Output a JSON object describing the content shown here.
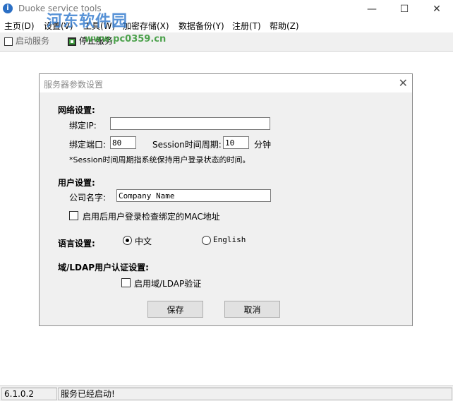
{
  "window": {
    "title": "Duoke service tools",
    "controls": {
      "minimize": "—",
      "maximize": "☐",
      "close": "✕"
    }
  },
  "watermark": {
    "text": "河东软件园",
    "url": "www.pc0359.cn"
  },
  "menu": {
    "items": [
      "主页(D)",
      "设置(V)",
      "工具(W)",
      "加密存储(X)",
      "数据备份(Y)",
      "注册(T)",
      "帮助(Z)"
    ]
  },
  "toolbar": {
    "start_label": "启动服务",
    "stop_label": "停止服务"
  },
  "dialog": {
    "title": "服务器参数设置",
    "network": {
      "heading": "网络设置:",
      "bind_ip_label": "绑定IP:",
      "bind_ip_value": "",
      "bind_port_label": "绑定端口:",
      "bind_port_value": "80",
      "session_label": "Session时间周期:",
      "session_value": "10",
      "session_unit": "分钟",
      "note": "*Session时间周期指系统保持用户登录状态的时间。"
    },
    "user": {
      "heading": "用户设置:",
      "company_label": "公司名字:",
      "company_value": "Company Name",
      "mac_check_label": "启用后用户登录检查绑定的MAC地址",
      "mac_check_checked": false
    },
    "language": {
      "heading": "语言设置:",
      "option_zh": "中文",
      "option_en": "English",
      "selected": "中文"
    },
    "ldap": {
      "heading": "域/LDAP用户认证设置:",
      "enable_label": "启用域/LDAP验证",
      "enable_checked": false
    },
    "save_label": "保存",
    "cancel_label": "取消"
  },
  "status": {
    "version": "6.1.0.2",
    "message": "服务已经启动!"
  }
}
